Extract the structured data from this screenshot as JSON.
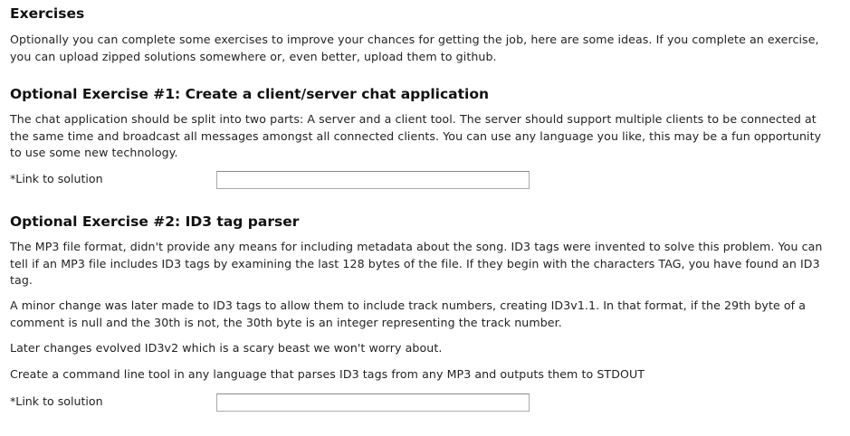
{
  "exercises": {
    "title": "Exercises",
    "intro_line1": "Optionally you can complete some exercises to improve your chances for getting the job, here are some ideas. If you complete an exercise,",
    "intro_line2": "you can upload zipped solutions somewhere or, even better, upload them to github."
  },
  "exercise1": {
    "title": "Optional Exercise #1: Create a client/server chat application",
    "desc_line1": "The chat application should be split into two parts: A server and a client tool. The server should support multiple clients to be connected at",
    "desc_line2": "the same time and broadcast all messages amongst all connected clients. You can use any language you like, this may be a fun opportunity",
    "desc_line3": "to use some new technology.",
    "link_label": "*Link to solution",
    "link_value": ""
  },
  "exercise2": {
    "title": "Optional Exercise #2: ID3 tag parser",
    "p1_line1": "The MP3 file format, didn't provide any means for including metadata about the song. ID3 tags were invented to solve this problem. You can",
    "p1_line2": "tell if an MP3 file includes ID3 tags by examining the last 128 bytes of the file. If they begin with the characters TAG, you have found an ID3",
    "p1_line3": "tag.",
    "p2_line1": "A minor change was later made to ID3 tags to allow them to include track numbers, creating ID3v1.1. In that format, if the 29th byte of a",
    "p2_line2": "comment is null and the 30th is not, the 30th byte is an integer representing the track number.",
    "p3": "Later changes evolved ID3v2 which is a scary beast we won't worry about.",
    "p4": "Create a command line tool in any language that parses ID3 tags from any MP3 and outputs them to STDOUT",
    "link_label": "*Link to solution",
    "link_value": ""
  }
}
